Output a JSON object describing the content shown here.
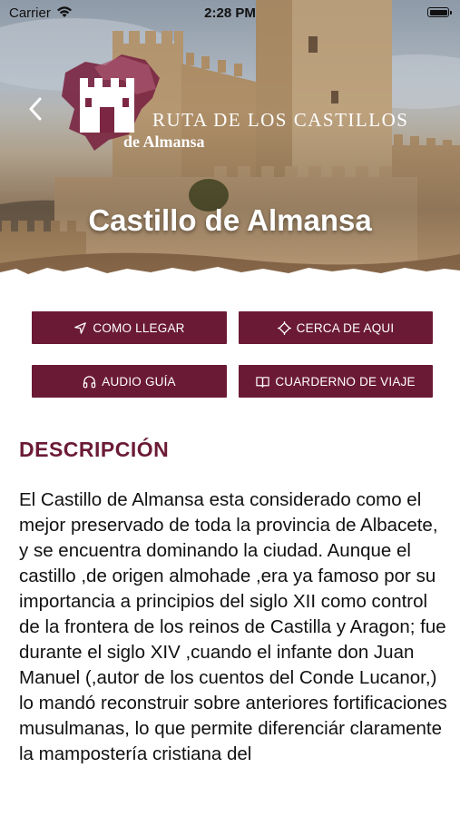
{
  "status_bar": {
    "carrier": "Carrier",
    "time": "2:28 PM"
  },
  "header": {
    "logo_title": "RUTA DE LOS CASTILLOS",
    "logo_subtitle": "de Almansa",
    "title": "Castillo de Almansa",
    "back_icon": "chevron-left-icon"
  },
  "actions": [
    {
      "label": "COMO LLEGAR",
      "icon": "navigation-arrow-icon"
    },
    {
      "label": "CERCA DE AQUI",
      "icon": "location-target-icon"
    },
    {
      "label": "AUDIO GUÍA",
      "icon": "headphones-icon"
    },
    {
      "label": "CUARDERNO DE VIAJE",
      "icon": "book-icon"
    }
  ],
  "section": {
    "heading": "DESCRIPCIÓN",
    "body": "El Castillo de Almansa esta considerado como el mejor preservado de toda la provincia de Albacete, y se encuentra dominando la ciudad. Aunque el castillo ,de origen almohade ,era ya famoso por su importancia a principios del siglo XII como control de la frontera de los reinos de Castilla y Aragon; fue durante el siglo XIV ,cuando el infante don Juan Manuel (,autor de los cuentos del Conde Lucanor,) lo mandó reconstruir sobre anteriores fortificaciones musulmanas, lo que permite diferenciár claramente la mampostería cristiana del"
  },
  "colors": {
    "brand": "#6b1a36",
    "heading": "#6b1a36",
    "text": "#111111",
    "button_text": "#ffffff"
  }
}
